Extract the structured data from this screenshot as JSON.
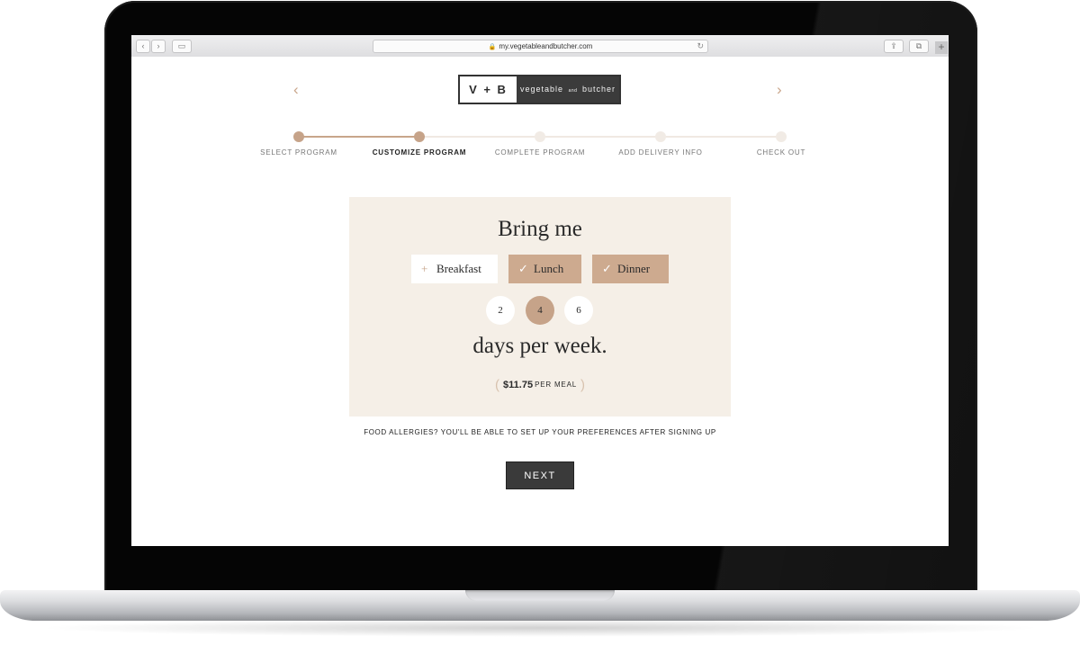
{
  "browser": {
    "url": "my.vegetableandbutcher.com",
    "back_icon": "‹",
    "forward_icon": "›",
    "sidebar_icon": "▭",
    "share_icon": "⇪",
    "tabs_icon": "⧉",
    "reload_icon": "↻",
    "lock_icon": "🔒",
    "newtab_icon": "+"
  },
  "header": {
    "prev_icon": "‹",
    "next_icon": "›",
    "logo_mark": "V + B",
    "logo_word_1": "vegetable",
    "logo_word_and": "and",
    "logo_word_2": "butcher"
  },
  "steps": [
    {
      "label": "SELECT PROGRAM",
      "state": "done"
    },
    {
      "label": "CUSTOMIZE PROGRAM",
      "state": "current"
    },
    {
      "label": "COMPLETE PROGRAM",
      "state": "todo"
    },
    {
      "label": "ADD DELIVERY INFO",
      "state": "todo"
    },
    {
      "label": "CHECK OUT",
      "state": "todo"
    }
  ],
  "card": {
    "heading": "Bring me",
    "meals": [
      {
        "label": "Breakfast",
        "selected": false,
        "icon": "+"
      },
      {
        "label": "Lunch",
        "selected": true,
        "icon": "✓"
      },
      {
        "label": "Dinner",
        "selected": true,
        "icon": "✓"
      }
    ],
    "days": [
      "2",
      "4",
      "6"
    ],
    "selected_days": "4",
    "subheading": "days per week.",
    "price_open": "(",
    "price_amount": "$11.75",
    "price_unit": "PER MEAL",
    "price_close": ")"
  },
  "allergy_note": "FOOD ALLERGIES? YOU'LL BE ABLE TO SET UP YOUR PREFERENCES AFTER SIGNING UP",
  "next_label": "NEXT",
  "colors": {
    "accent": "#c6a389",
    "card_bg": "#f5efe7",
    "button_dark": "#3a3a3a"
  }
}
